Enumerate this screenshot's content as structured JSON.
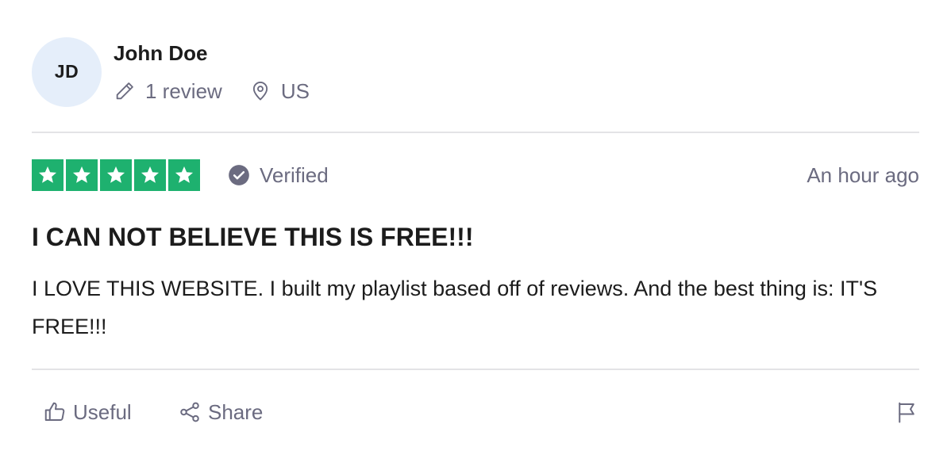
{
  "reviewer": {
    "initials": "JD",
    "name": "John Doe",
    "review_count": "1 review",
    "location": "US"
  },
  "review": {
    "rating": 5,
    "rating_max": 5,
    "verified_label": "Verified",
    "date": "An hour ago",
    "title": "I CAN NOT BELIEVE THIS IS FREE!!!",
    "body": "I LOVE THIS WEBSITE. I built my playlist based off of reviews. And the best thing is: IT'S FREE!!!"
  },
  "actions": {
    "useful_label": "Useful",
    "share_label": "Share"
  },
  "colors": {
    "star_green": "#1eb16f",
    "avatar_bg": "#e5eefa",
    "muted_text": "#6b6b80",
    "divider": "#e3e3e6"
  },
  "icons": [
    "pencil-icon",
    "location-pin-icon",
    "star-icon",
    "verified-check-icon",
    "thumbs-up-icon",
    "share-icon",
    "flag-icon"
  ]
}
